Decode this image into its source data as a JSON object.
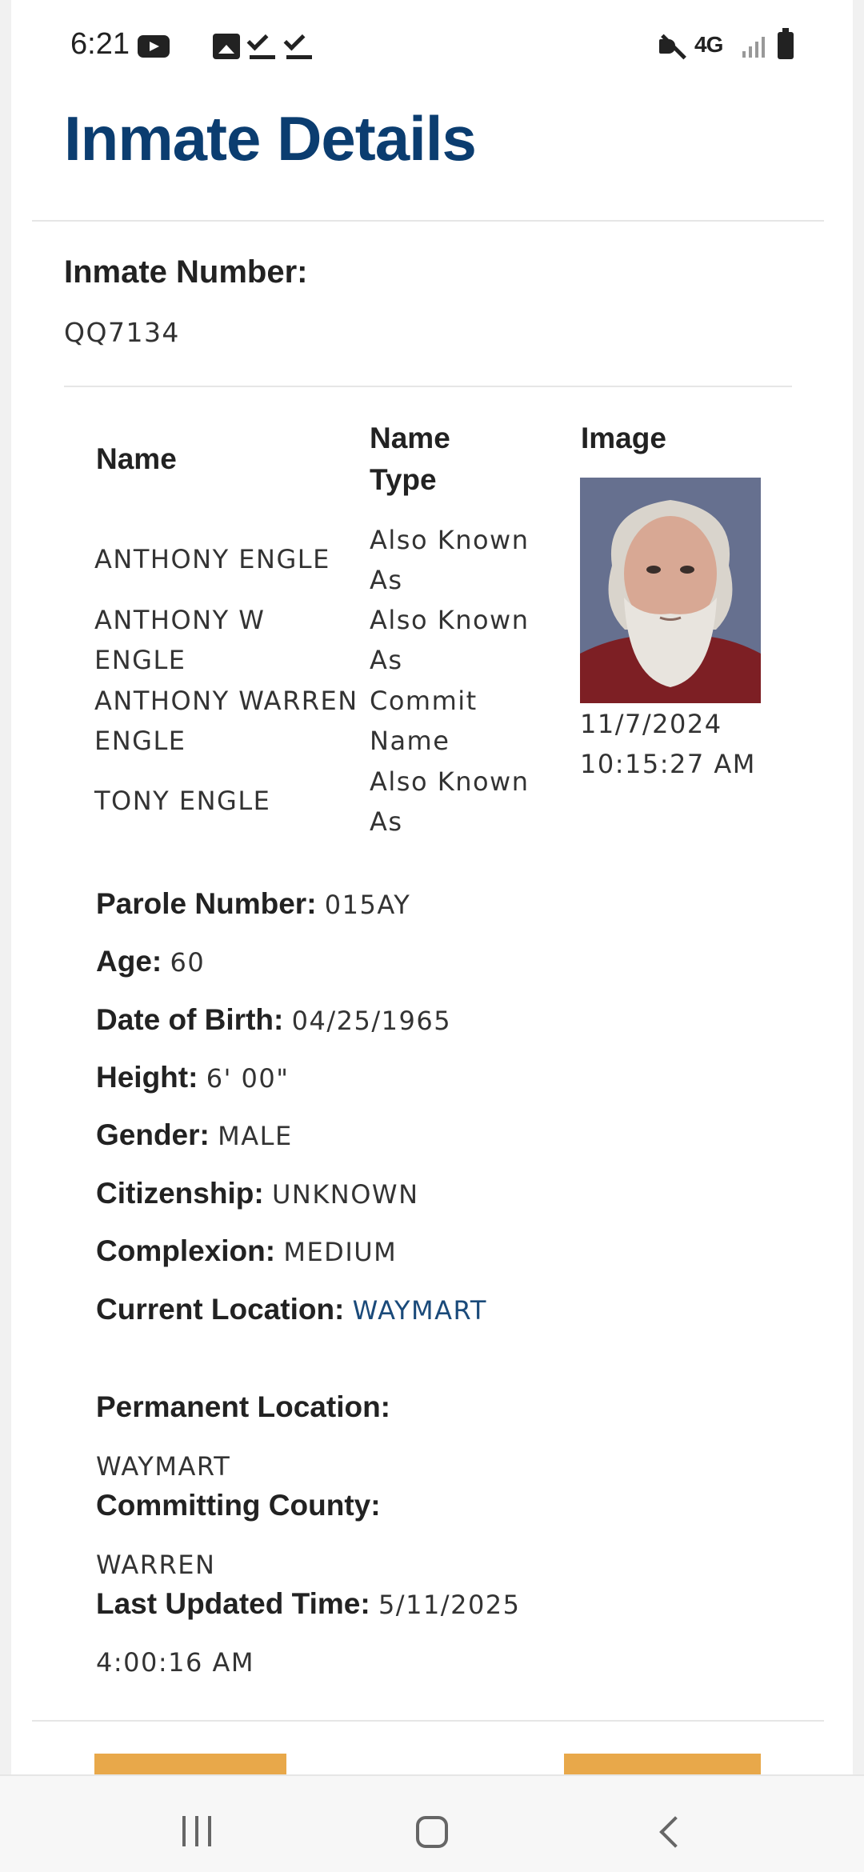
{
  "status_bar": {
    "time": "6:21",
    "network": "4G",
    "icons": [
      "youtube-icon",
      "gallery-icon",
      "check-icon",
      "check-icon",
      "mute-icon",
      "signal-icon",
      "battery-icon"
    ]
  },
  "header": {
    "title": "Inmate Details"
  },
  "inmate": {
    "number_label": "Inmate Number:",
    "number": "QQ7134"
  },
  "names_table": {
    "headers": {
      "name": "Name",
      "name_type": "Name Type",
      "image": "Image"
    },
    "rows": [
      {
        "name": "ANTHONY ENGLE",
        "type": "Also Known As"
      },
      {
        "name": "ANTHONY W ENGLE",
        "type": "Also Known As"
      },
      {
        "name": "ANTHONY WARREN ENGLE",
        "type": "Commit Name"
      },
      {
        "name": "TONY ENGLE",
        "type": "Also Known As"
      }
    ],
    "photo_timestamp": "11/7/2024 10:15:27 AM"
  },
  "details": {
    "parole_label": "Parole Number:",
    "parole": "015AY",
    "age_label": "Age:",
    "age": "60",
    "dob_label": "Date of Birth:",
    "dob": "04/25/1965",
    "height_label": "Height:",
    "height": "6' 00\"",
    "gender_label": "Gender:",
    "gender": "MALE",
    "citizenship_label": "Citizenship:",
    "citizenship": "UNKNOWN",
    "complexion_label": "Complexion:",
    "complexion": "MEDIUM",
    "current_location_label": "Current Location:",
    "current_location": "WAYMART",
    "permanent_location_label": "Permanent Location:",
    "permanent_location": "WAYMART",
    "committing_county_label": "Committing County:",
    "committing_county": "WARREN",
    "last_updated_label": "Last Updated Time:",
    "last_updated_date": "5/11/2025",
    "last_updated_time": "4:00:16 AM"
  },
  "colors": {
    "title": "#0b3d70",
    "link": "#1a4a7a",
    "button": "#e8a84a"
  },
  "nav": {
    "icons": [
      "recent-apps-icon",
      "home-icon",
      "back-icon"
    ]
  }
}
